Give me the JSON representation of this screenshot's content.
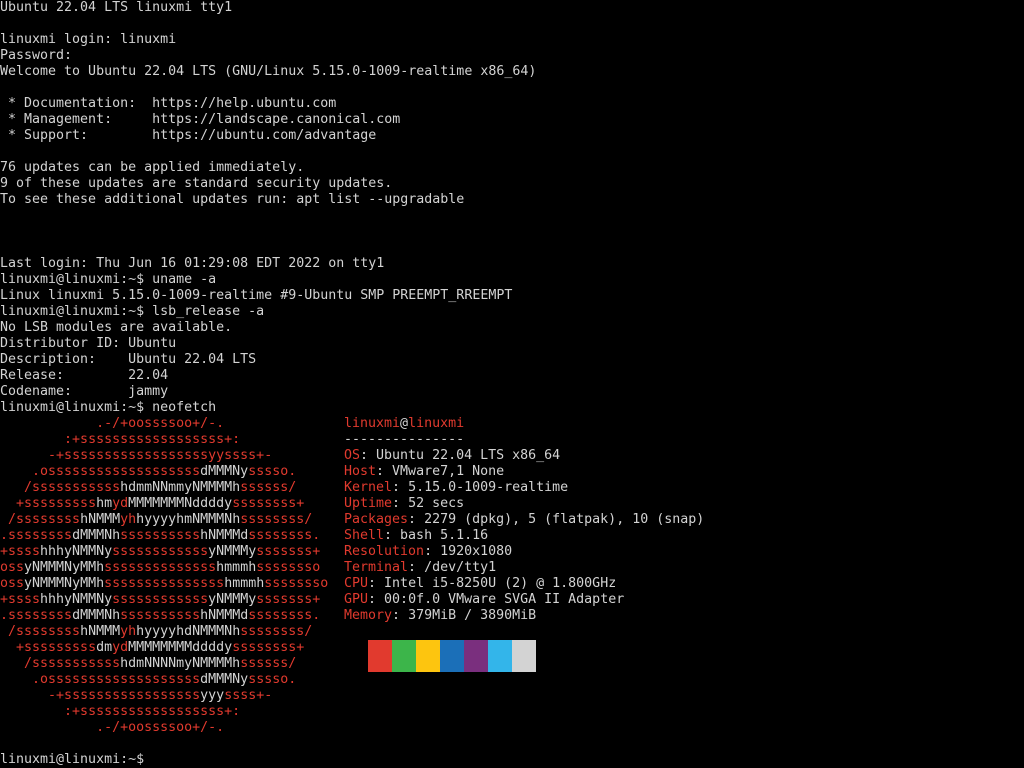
{
  "terminal": {
    "header": "Ubuntu 22.04 LTS linuxmi tty1",
    "login_prompt": "linuxmi login: linuxmi",
    "password_prompt": "Password:",
    "welcome": "Welcome to Ubuntu 22.04 LTS (GNU/Linux 5.15.0-1009-realtime x86_64)",
    "links": [
      " * Documentation:  https://help.ubuntu.com",
      " * Management:     https://landscape.canonical.com",
      " * Support:        https://ubuntu.com/advantage"
    ],
    "updates": [
      "76 updates can be applied immediately.",
      "9 of these updates are standard security updates.",
      "To see these additional updates run: apt list --upgradable"
    ],
    "last_login": "Last login: Thu Jun 16 01:29:08 EDT 2022 on tty1",
    "session": [
      "linuxmi@linuxmi:~$ uname -a",
      "Linux linuxmi 5.15.0-1009-realtime #9-Ubuntu SMP PREEMPT_RREEMPT",
      "linuxmi@linuxmi:~$ lsb_release -a",
      "No LSB modules are available.",
      "Distributor ID: Ubuntu",
      "Description:    Ubuntu 22.04 LTS",
      "Release:        22.04",
      "Codename:       jammy",
      "linuxmi@linuxmi:~$ neofetch"
    ],
    "final_prompt": "linuxmi@linuxmi:~$ "
  },
  "neofetch": {
    "title_user": "linuxmi",
    "title_at": "@",
    "title_host": "linuxmi",
    "separator": "---------------",
    "info": [
      {
        "key": "OS",
        "value": "Ubuntu 22.04 LTS x86_64"
      },
      {
        "key": "Host",
        "value": "VMware7,1 None"
      },
      {
        "key": "Kernel",
        "value": "5.15.0-1009-realtime"
      },
      {
        "key": "Uptime",
        "value": "52 secs"
      },
      {
        "key": "Packages",
        "value": "2279 (dpkg), 5 (flatpak), 10 (snap)"
      },
      {
        "key": "Shell",
        "value": "bash 5.1.16"
      },
      {
        "key": "Resolution",
        "value": "1920x1080"
      },
      {
        "key": "Terminal",
        "value": "/dev/tty1"
      },
      {
        "key": "CPU",
        "value": "Intel i5-8250U (2) @ 1.800GHz"
      },
      {
        "key": "GPU",
        "value": "00:0f.0 VMware SVGA II Adapter"
      },
      {
        "key": "Memory",
        "value": "379MiB / 3890MiB"
      }
    ],
    "logo_lines": [
      [
        [
          "            ",
          ""
        ],
        [
          ".-/+oossssoo+/-.",
          "r"
        ]
      ],
      [
        [
          "        ",
          ""
        ],
        [
          ":+ssssssssssssssssss+:",
          "r"
        ]
      ],
      [
        [
          "      ",
          ""
        ],
        [
          "-+ssssssssssssssssssyyssss+-",
          "r"
        ]
      ],
      [
        [
          "    ",
          ""
        ],
        [
          ".osssssssssssssssssss",
          "r"
        ],
        [
          "dMMMNy",
          ""
        ],
        [
          "sssso.",
          "r"
        ]
      ],
      [
        [
          "   ",
          ""
        ],
        [
          "/sssssssssss",
          "r"
        ],
        [
          "hdmmNNmmyNMMMMh",
          ""
        ],
        [
          "ssssss/",
          "r"
        ]
      ],
      [
        [
          "  ",
          ""
        ],
        [
          "+sssssssss",
          "r"
        ],
        [
          "hm",
          ""
        ],
        [
          "yd",
          "r"
        ],
        [
          "MMMMMMMNddddy",
          ""
        ],
        [
          "ssssssss+",
          "r"
        ]
      ],
      [
        [
          " ",
          ""
        ],
        [
          "/ssssssss",
          "r"
        ],
        [
          "hNMMM",
          ""
        ],
        [
          "yh",
          "r"
        ],
        [
          "hyyyyhmNMMMNh",
          ""
        ],
        [
          "ssssssss/",
          "r"
        ]
      ],
      [
        [
          ".ssssssss",
          "r"
        ],
        [
          "dMMMNh",
          ""
        ],
        [
          "ssssssssss",
          "r"
        ],
        [
          "hNMMMd",
          ""
        ],
        [
          "ssssssss.",
          "r"
        ]
      ],
      [
        [
          "+ssss",
          "r"
        ],
        [
          "hhhyNMMNy",
          ""
        ],
        [
          "ssssssssssss",
          "r"
        ],
        [
          "yNMMMy",
          ""
        ],
        [
          "sssssss+",
          "r"
        ]
      ],
      [
        [
          "oss",
          "r"
        ],
        [
          "yNMMMNyMMh",
          ""
        ],
        [
          "ssssssssssssss",
          "r"
        ],
        [
          "hmmmh",
          ""
        ],
        [
          "ssssssso",
          "r"
        ]
      ],
      [
        [
          "oss",
          "r"
        ],
        [
          "yNMMMNyMMh",
          ""
        ],
        [
          "sssssssssssssss",
          "r"
        ],
        [
          "hmmmh",
          ""
        ],
        [
          "ssssssso",
          "r"
        ]
      ],
      [
        [
          "+ssss",
          "r"
        ],
        [
          "hhhyNMMNy",
          ""
        ],
        [
          "ssssssssssss",
          "r"
        ],
        [
          "yNMMMy",
          ""
        ],
        [
          "sssssss+",
          "r"
        ]
      ],
      [
        [
          ".ssssssss",
          "r"
        ],
        [
          "dMMMNh",
          ""
        ],
        [
          "ssssssssss",
          "r"
        ],
        [
          "hNMMMd",
          ""
        ],
        [
          "ssssssss.",
          "r"
        ]
      ],
      [
        [
          " ",
          ""
        ],
        [
          "/ssssssss",
          "r"
        ],
        [
          "hNMMM",
          ""
        ],
        [
          "yh",
          "r"
        ],
        [
          "hyyyyhdNMMMNh",
          ""
        ],
        [
          "ssssssss/",
          "r"
        ]
      ],
      [
        [
          "  ",
          ""
        ],
        [
          "+sssssssss",
          "r"
        ],
        [
          "dm",
          ""
        ],
        [
          "yd",
          "r"
        ],
        [
          "MMMMMMMMddddy",
          ""
        ],
        [
          "ssssssss+",
          "r"
        ]
      ],
      [
        [
          "   ",
          ""
        ],
        [
          "/sssssssssss",
          "r"
        ],
        [
          "hdmNNNNmyNMMMMh",
          ""
        ],
        [
          "ssssss/",
          "r"
        ]
      ],
      [
        [
          "    ",
          ""
        ],
        [
          ".osssssssssssssssssss",
          "r"
        ],
        [
          "dMMMNy",
          ""
        ],
        [
          "sssso.",
          "r"
        ]
      ],
      [
        [
          "      ",
          ""
        ],
        [
          "-+sssssssssssssssss",
          "r"
        ],
        [
          "yyy",
          ""
        ],
        [
          "ssss+-",
          "r"
        ]
      ],
      [
        [
          "        ",
          ""
        ],
        [
          ":+ssssssssssssssssss+:",
          "r"
        ]
      ],
      [
        [
          "            ",
          ""
        ],
        [
          ".-/+oossssoo+/-.",
          "r"
        ]
      ]
    ],
    "palette": [
      "#e13a2e",
      "#3cb54a",
      "#fdc50f",
      "#1b6fb8",
      "#7a2f7e",
      "#33b5ea",
      "#d3d3d3"
    ]
  }
}
